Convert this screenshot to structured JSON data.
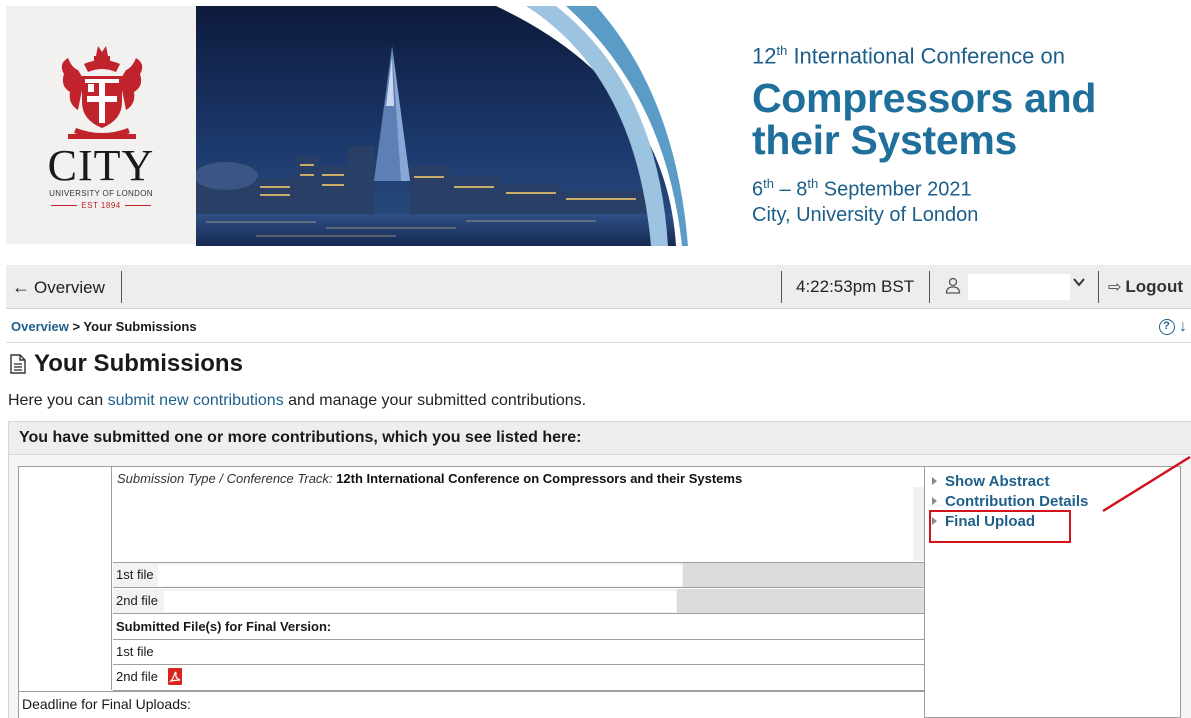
{
  "banner": {
    "city_name": "CITY",
    "city_sub": "UNIVERSITY OF LONDON",
    "city_est": "EST 1894",
    "conf_ordinal": "12",
    "conf_ordinal_suffix": "th",
    "conf_line1_rest": " International Conference on",
    "conf_title_line1": "Compressors and",
    "conf_title_line2": "their Systems",
    "dates_start": "6",
    "dates_start_suffix": "th",
    "dates_mid": " – 8",
    "dates_end_suffix": "th",
    "dates_rest": " September 2021",
    "venue": "City, University of London",
    "colors": {
      "brand_blue": "#1f6f9c",
      "city_red": "#c0232b"
    }
  },
  "navbar": {
    "back_label": "Overview",
    "time": "4:22:53pm  BST",
    "user_value": "",
    "logout_label": "Logout"
  },
  "breadcrumb": {
    "link": "Overview",
    "separator": " > ",
    "current": "Your Submissions"
  },
  "page": {
    "title": "Your Submissions",
    "intro_before": "Here you can ",
    "intro_link": "submit new contributions",
    "intro_after": " and manage your submitted contributions."
  },
  "panel": {
    "heading": "You have submitted one or more contributions, which you see listed here:",
    "submission_type_label": "Submission Type / Conference Track:",
    "submission_type_value": "12th International Conference on Compressors and their Systems",
    "file_rows": [
      {
        "label": "1st file"
      },
      {
        "label": "2nd file"
      }
    ],
    "final_header": "Submitted File(s) for Final Version:",
    "final_rows": [
      {
        "label": "1st file"
      },
      {
        "label": "2nd file"
      }
    ],
    "deadline_label": "Deadline for Final Uploads:"
  },
  "actions": [
    {
      "label": "Show Abstract"
    },
    {
      "label": "Contribution Details"
    },
    {
      "label": "Final Upload"
    }
  ]
}
